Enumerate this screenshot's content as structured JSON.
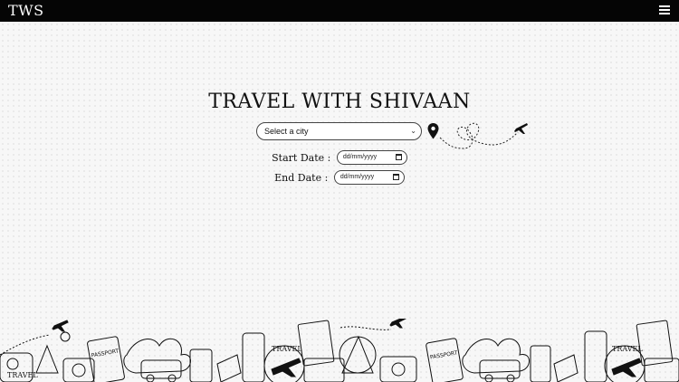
{
  "nav": {
    "brand": "TWS",
    "menu_icon": "hamburger-menu-icon"
  },
  "hero": {
    "title": "TRAVEL WITH SHIVAAN"
  },
  "search": {
    "city_placeholder": "Select a city"
  },
  "dates": {
    "start_label": "Start Date :",
    "start_value": "dd/mm/yyyy",
    "end_label": "End Date :",
    "end_value": "dd/mm/yyyy"
  },
  "decor": {
    "pin_icon": "map-pin-icon",
    "flight_path_icon": "heart-flight-path-icon",
    "footer": [
      "travel-bag-icon",
      "airplane-icon",
      "passport-icon",
      "camera-icon",
      "flower-icon",
      "van-icon",
      "globe-icon",
      "map-icon"
    ],
    "footer_labels": [
      "TRAVEL",
      "PASSPORT",
      "TRAVEL",
      "TRAVEL",
      "PASSPORT"
    ]
  }
}
